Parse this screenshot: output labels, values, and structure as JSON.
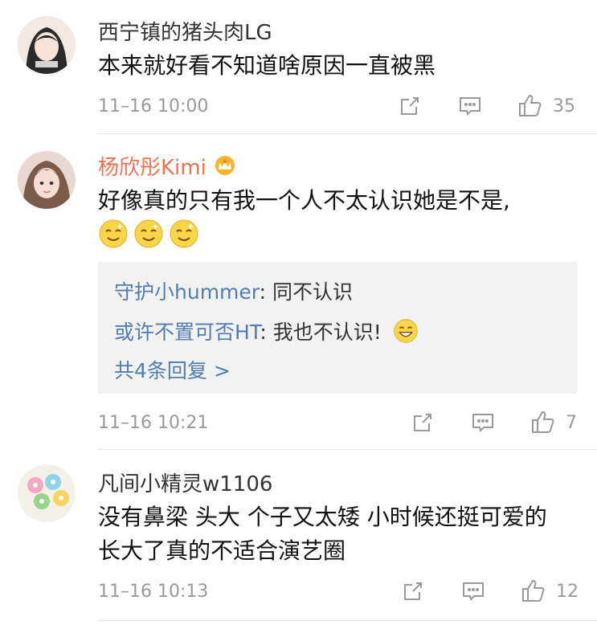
{
  "comments": [
    {
      "user": "西宁镇的猪头肉LG",
      "text": "本来就好看不知道啥原因一直被黑",
      "time": "11–16 10:00",
      "likes": "35"
    },
    {
      "user": "杨欣彤Kimi",
      "text": "好像真的只有我一个人不太认识她是不是,",
      "time": "11–16 10:21",
      "likes": "7",
      "replies": [
        {
          "user": "守护小hummer",
          "sep": ": ",
          "text": "同不认识"
        },
        {
          "user": "或许不置可否HT",
          "sep": ": ",
          "text": "我也不认识!"
        }
      ],
      "more_replies": "共4条回复 >"
    },
    {
      "user": "凡间小精灵w1106",
      "text_line1": "没有鼻梁 头大 个子又太矮 小时候还挺可爱的",
      "text_line2": "长大了真的不适合演艺圈",
      "time": "11–16 10:13",
      "likes": "12"
    }
  ],
  "icons": {
    "repost": "share-icon",
    "comment": "comment-icon",
    "like": "thumbs-up-icon",
    "vip": "crown-icon",
    "emoji": "smile-emoji-icon"
  },
  "colors": {
    "vip_name": "#eb7350",
    "reply_name": "#507daf",
    "reply_bg": "#f2f2f2",
    "meta": "#999999"
  }
}
